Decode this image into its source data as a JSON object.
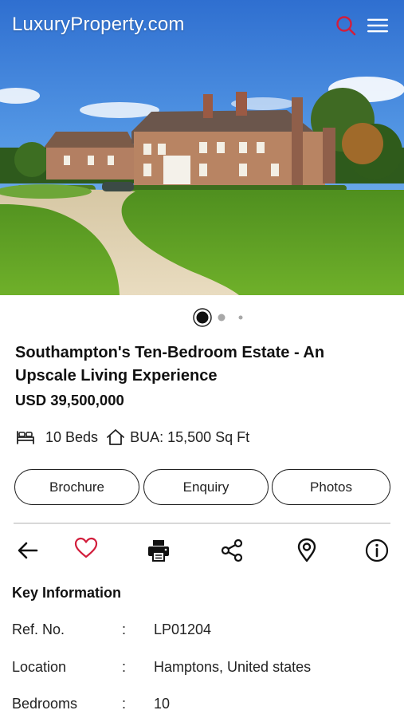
{
  "header": {
    "logo": "LuxuryProperty.com",
    "icons": {
      "search": "search-icon",
      "menu": "hamburger-menu-icon"
    },
    "accent_color": "#d21e3c"
  },
  "carousel": {
    "count": 3,
    "active_index": 0
  },
  "listing": {
    "title": "Southampton's Ten-Bedroom Estate - An Upscale Living Experience",
    "price": "USD 39,500,000",
    "beds": "10 Beds",
    "bua": "BUA: 15,500 Sq Ft"
  },
  "buttons": {
    "brochure": "Brochure",
    "enquiry": "Enquiry",
    "photos": "Photos"
  },
  "actions": [
    "back-arrow-icon",
    "heart-icon",
    "print-icon",
    "share-icon",
    "location-pin-icon",
    "info-icon"
  ],
  "key_information": {
    "heading": "Key Information",
    "separator": ":",
    "rows": [
      {
        "label": "Ref. No.",
        "value": "LP01204"
      },
      {
        "label": "Location",
        "value": "Hamptons, United states"
      },
      {
        "label": "Bedrooms",
        "value": "10"
      }
    ]
  }
}
